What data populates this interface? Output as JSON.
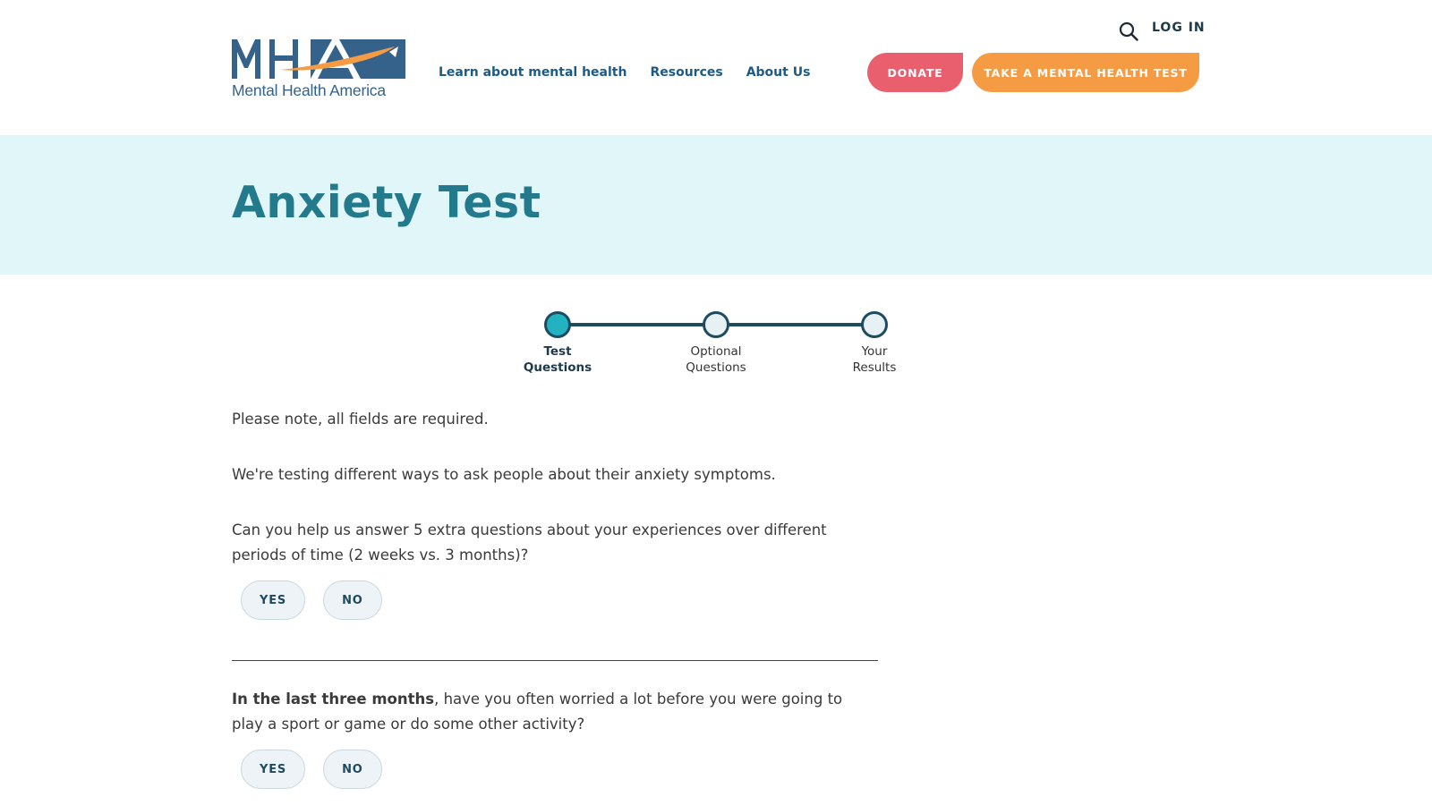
{
  "header": {
    "logo_wordmark": "MHA",
    "logo_text": "Mental Health America",
    "nav": [
      {
        "label": "Learn about mental health"
      },
      {
        "label": "Resources"
      },
      {
        "label": "About Us"
      }
    ],
    "search_icon": "search-icon",
    "login_label": "LOG IN",
    "donate_label": "DONATE",
    "test_label": "TAKE A MENTAL HEALTH TEST"
  },
  "hero": {
    "title": "Anxiety Test"
  },
  "stepper": {
    "steps": [
      {
        "line1": "Test",
        "line2": "Questions",
        "active": true
      },
      {
        "line1": "Optional",
        "line2": "Questions",
        "active": false
      },
      {
        "line1": "Your",
        "line2": "Results",
        "active": false
      }
    ]
  },
  "content": {
    "note": "Please note, all fields are required.",
    "intro": "We're testing different ways to ask people about their anxiety symptoms.",
    "question1": "Can you help us answer 5 extra questions about your experiences over different periods of time (2 weeks vs. 3 months)?",
    "question2_bold": "In the last three months",
    "question2_rest": ", have you often worried a lot before you were going to play a sport or game or do some other activity?",
    "yes_label": "YES",
    "no_label": "NO"
  },
  "colors": {
    "brand_blue": "#1d5b86",
    "title_teal": "#227a8c",
    "hero_bg": "#e0f6f8",
    "donate": "#ea5f6e",
    "take_test": "#f59b43",
    "step_active": "#23b3c0"
  }
}
